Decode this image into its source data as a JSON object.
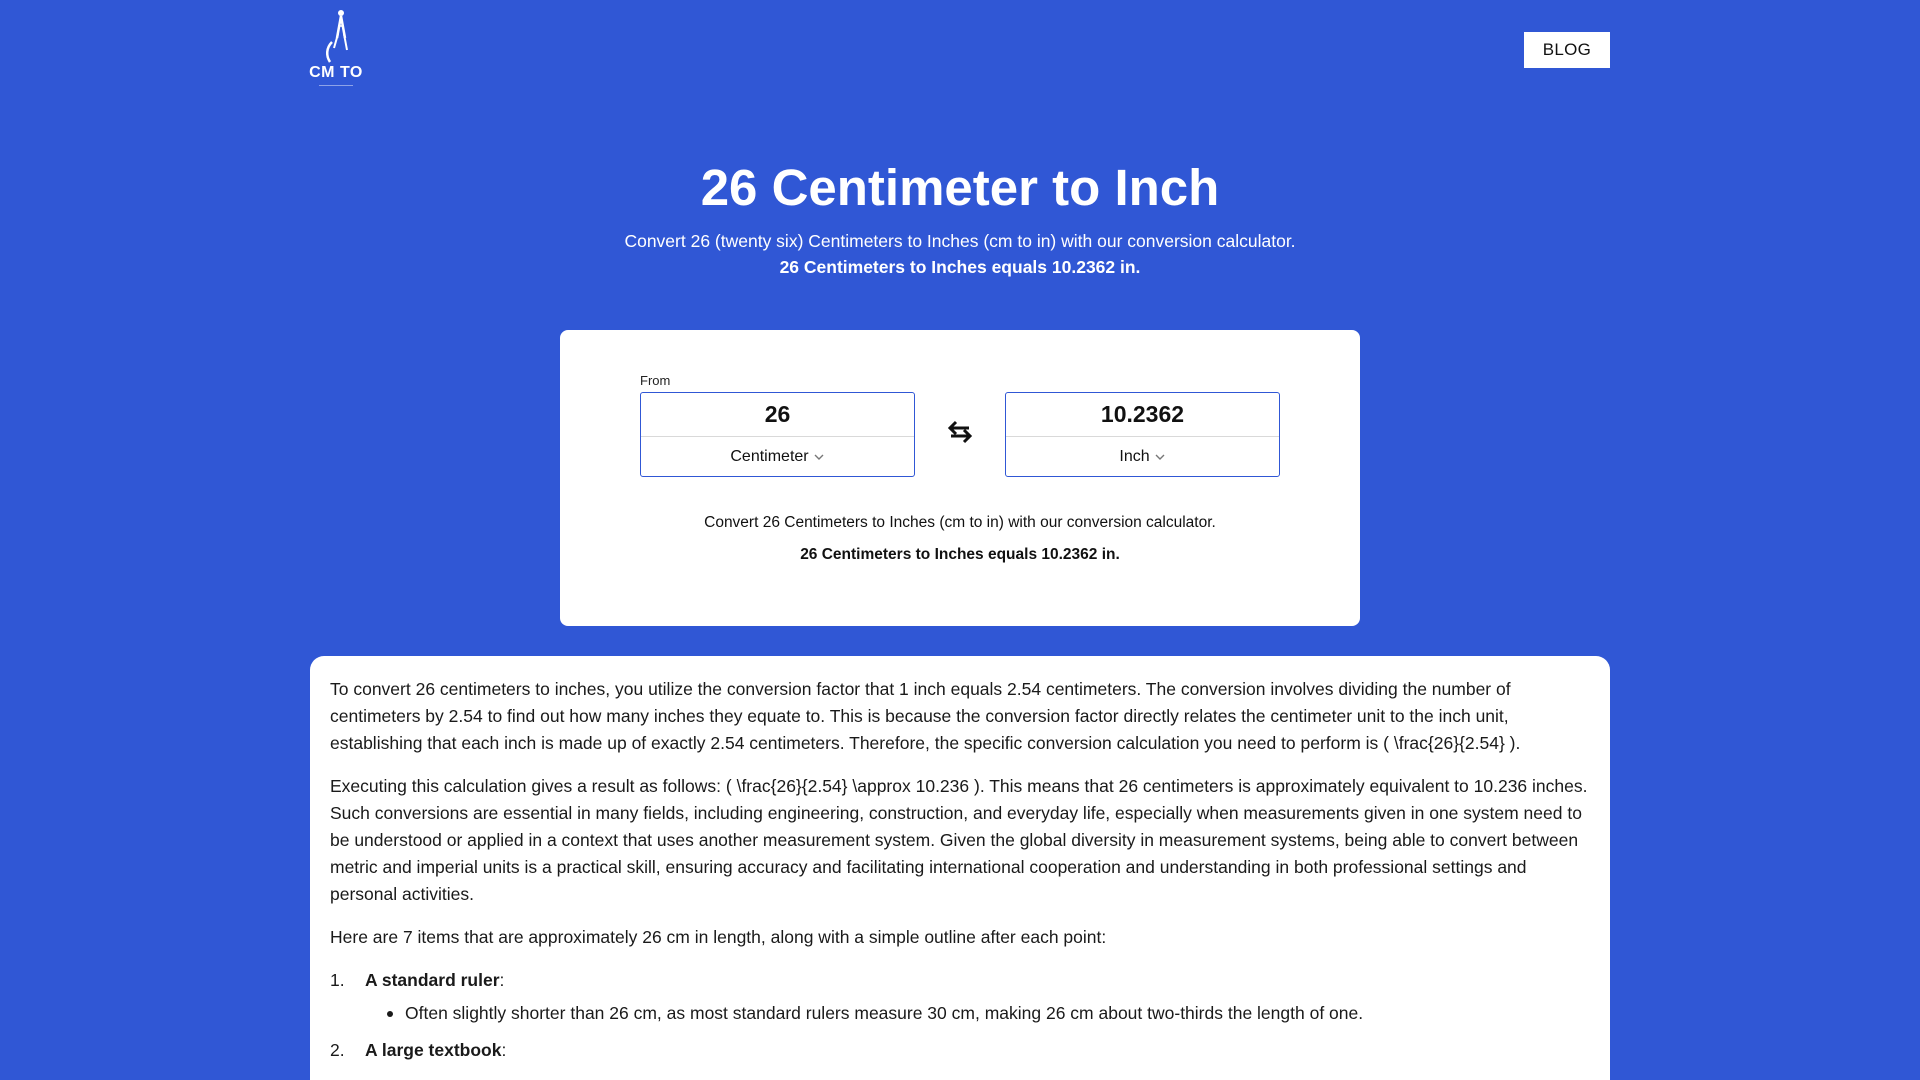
{
  "header": {
    "logo_text": "CM TO",
    "blog_label": "BLOG"
  },
  "hero": {
    "title": "26 Centimeter to Inch",
    "subtitle": "Convert 26 (twenty six) Centimeters to Inches (cm to in) with our conversion calculator.",
    "result": "26 Centimeters to Inches equals 10.2362 in."
  },
  "calculator": {
    "from_label": "From",
    "from_value": "26",
    "from_unit": "Centimeter",
    "to_value": "10.2362",
    "to_unit": "Inch",
    "swap_icon": "swap-arrows-icon",
    "description": "Convert 26 Centimeters to Inches (cm to in) with our conversion calculator.",
    "result": "26 Centimeters to Inches equals 10.2362 in."
  },
  "article": {
    "paragraphs": [
      "To convert 26 centimeters to inches, you utilize the conversion factor that 1 inch equals 2.54 centimeters. The conversion involves dividing the number of centimeters by 2.54 to find out how many inches they equate to. This is because the conversion factor directly relates the centimeter unit to the inch unit, establishing that each inch is made up of exactly 2.54 centimeters. Therefore, the specific conversion calculation you need to perform is ( \\frac{26}{2.54} ).",
      "Executing this calculation gives a result as follows: ( \\frac{26}{2.54} \\approx 10.236 ). This means that 26 centimeters is approximately equivalent to 10.236 inches. Such conversions are essential in many fields, including engineering, construction, and everyday life, especially when measurements given in one system need to be understood or applied in a context that uses another measurement system. Given the global diversity in measurement systems, being able to convert between metric and imperial units is a practical skill, ensuring accuracy and facilitating international cooperation and understanding in both professional settings and personal activities.",
      "Here are 7 items that are approximately 26 cm in length, along with a simple outline after each point:"
    ],
    "items": [
      {
        "number": "1.",
        "title": "A standard ruler",
        "suffix": ":",
        "bullet": "Often slightly shorter than 26 cm, as most standard rulers measure 30 cm, making 26 cm about two-thirds the length of one."
      },
      {
        "number": "2.",
        "title": "A large textbook",
        "suffix": ":"
      }
    ]
  }
}
